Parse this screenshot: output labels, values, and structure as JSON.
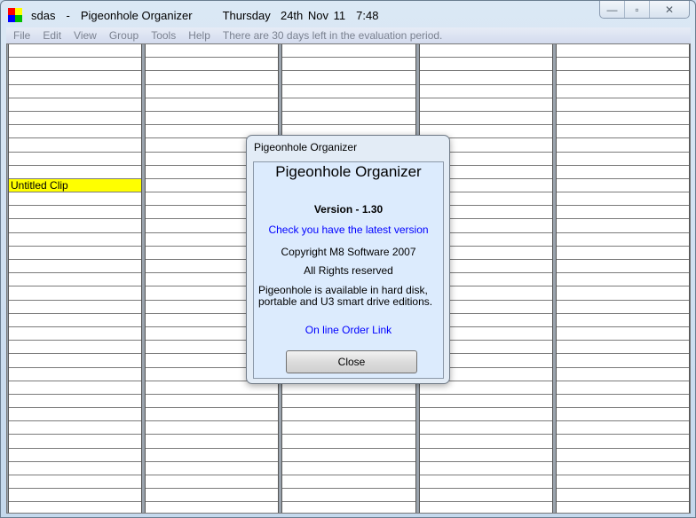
{
  "window": {
    "document_name": "sdas",
    "separator": "-",
    "app_name": "Pigeonhole Organizer",
    "date": "Thursday  24th Nov 11",
    "time": "7:48",
    "app_icon_colors": [
      "#ff0000",
      "#ffff00",
      "#0000ff",
      "#00c000"
    ],
    "controls": {
      "minimize": "—",
      "maximize": "▫",
      "close": "✕"
    }
  },
  "menu": {
    "items": [
      "File",
      "Edit",
      "View",
      "Group",
      "Tools",
      "Help"
    ],
    "notice": "There are 30 days left in the evaluation period."
  },
  "grid": {
    "columns": 5,
    "rows": 35,
    "clips": [
      {
        "column": 0,
        "row": 10,
        "label": "Untitled Clip",
        "color": "#ffff00"
      }
    ]
  },
  "dialog": {
    "title": "Pigeonhole Organizer",
    "heading": "Pigeonhole Organizer",
    "version": "Version - 1.30",
    "check_link": "Check you have the latest version",
    "copyright": "Copyright M8 Software 2007",
    "rights": "All Rights reserved",
    "availability_line1": "Pigeonhole is available in hard disk,",
    "availability_line2": "portable and U3 smart drive editions.",
    "order_link": "On line Order Link",
    "close_label": "Close"
  }
}
